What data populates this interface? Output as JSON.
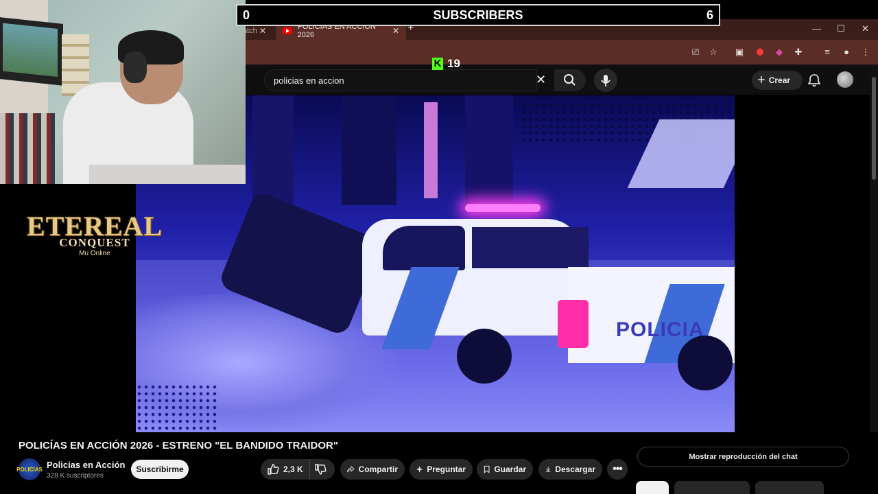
{
  "overlay": {
    "subscribers_left": "0",
    "subscribers_label": "SUBSCRIBERS",
    "subscribers_right": "6",
    "kick_count": "19"
  },
  "browser": {
    "prev_tab_fragment": "atch",
    "active_tab_title": "POLICIAS EN ACCION 2026",
    "toolbar_icons": [
      "cast-icon",
      "star-icon",
      "extension-a-icon",
      "extension-red-icon",
      "extension-u-icon",
      "puzzle-icon",
      "playlist-icon",
      "profile-icon",
      "kebab-icon"
    ]
  },
  "youtube": {
    "search_value": "policias en accion",
    "create_label": "Crear"
  },
  "logo": {
    "title": "ETEREAL",
    "subtitle": "CONQUEST",
    "small": "Mu Online"
  },
  "video": {
    "title": "POLICÍAS EN ACCIÓN 2026 - ESTRENO \"EL BANDIDO TRAIDOR\"",
    "scene_text": "POLICIA"
  },
  "channel": {
    "name": "Policias en Acción",
    "subscribers": "328 K suscriptores",
    "subscribe_label": "Suscribirme"
  },
  "actions": {
    "likes": "2,3 K",
    "share": "Compartir",
    "ask": "Preguntar",
    "save": "Guardar",
    "download": "Descargar",
    "more": "•••"
  },
  "chat": {
    "replay_label": "Mostrar reproducción del chat"
  },
  "colors": {
    "youtube_bg": "#0f0f0f",
    "browser_tab_bg": "#5a2d27",
    "kick_green": "#53fc18",
    "video_tint": "#4a4ad8"
  }
}
